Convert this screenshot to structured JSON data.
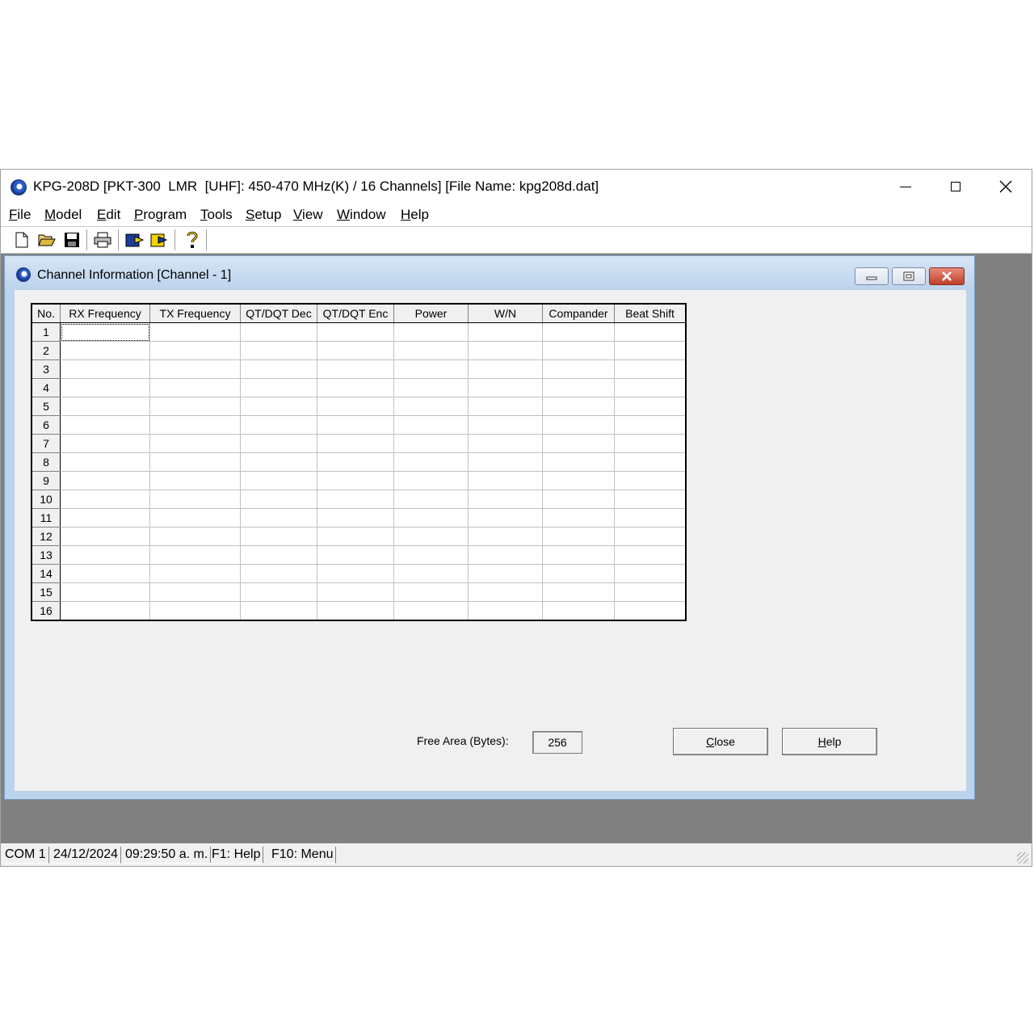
{
  "app": {
    "title": "KPG-208D [PKT-300  LMR  [UHF]: 450-470 MHz(K) / 16 Channels] [File Name: kpg208d.dat]"
  },
  "menu": [
    {
      "label": "File",
      "accel": "F",
      "rest": "ile"
    },
    {
      "label": "Model",
      "accel": "M",
      "rest": "odel"
    },
    {
      "label": "Edit",
      "accel": "E",
      "rest": "dit"
    },
    {
      "label": "Program",
      "accel": "P",
      "rest": "rogram"
    },
    {
      "label": "Tools",
      "accel": "T",
      "rest": "ools"
    },
    {
      "label": "Setup",
      "accel": "S",
      "rest": "etup"
    },
    {
      "label": "View",
      "accel": "V",
      "rest": "iew"
    },
    {
      "label": "Window",
      "accel": "W",
      "rest": "indow"
    },
    {
      "label": "Help",
      "accel": "H",
      "rest": "elp"
    }
  ],
  "toolbar": {
    "icons": [
      "new-file-icon",
      "open-folder-icon",
      "save-disk-icon",
      "print-icon",
      "read-radio-icon",
      "write-radio-icon",
      "help-question-icon"
    ]
  },
  "child": {
    "title": "Channel Information [Channel - 1]"
  },
  "table": {
    "headers": [
      "No.",
      "RX Frequency",
      "TX Frequency",
      "QT/DQT Dec",
      "QT/DQT Enc",
      "Power",
      "W/N",
      "Compander",
      "Beat Shift"
    ],
    "rows": [
      "1",
      "2",
      "3",
      "4",
      "5",
      "6",
      "7",
      "8",
      "9",
      "10",
      "11",
      "12",
      "13",
      "14",
      "15",
      "16"
    ],
    "selected_row": 1,
    "selected_column": "RX Frequency"
  },
  "free_area": {
    "label": "Free Area (Bytes):",
    "value": "256"
  },
  "buttons": {
    "close_accel": "C",
    "close_rest": "lose",
    "help_accel": "H",
    "help_rest": "elp"
  },
  "status": {
    "port": "COM 1",
    "date": "24/12/2024",
    "time": "09:29:50 a. m.",
    "f1": "F1: Help",
    "f10": "F10: Menu"
  },
  "colors": {
    "mdi_background": "#808080",
    "child_frame": "#bcd3ec",
    "close_button": "#c0402a"
  }
}
